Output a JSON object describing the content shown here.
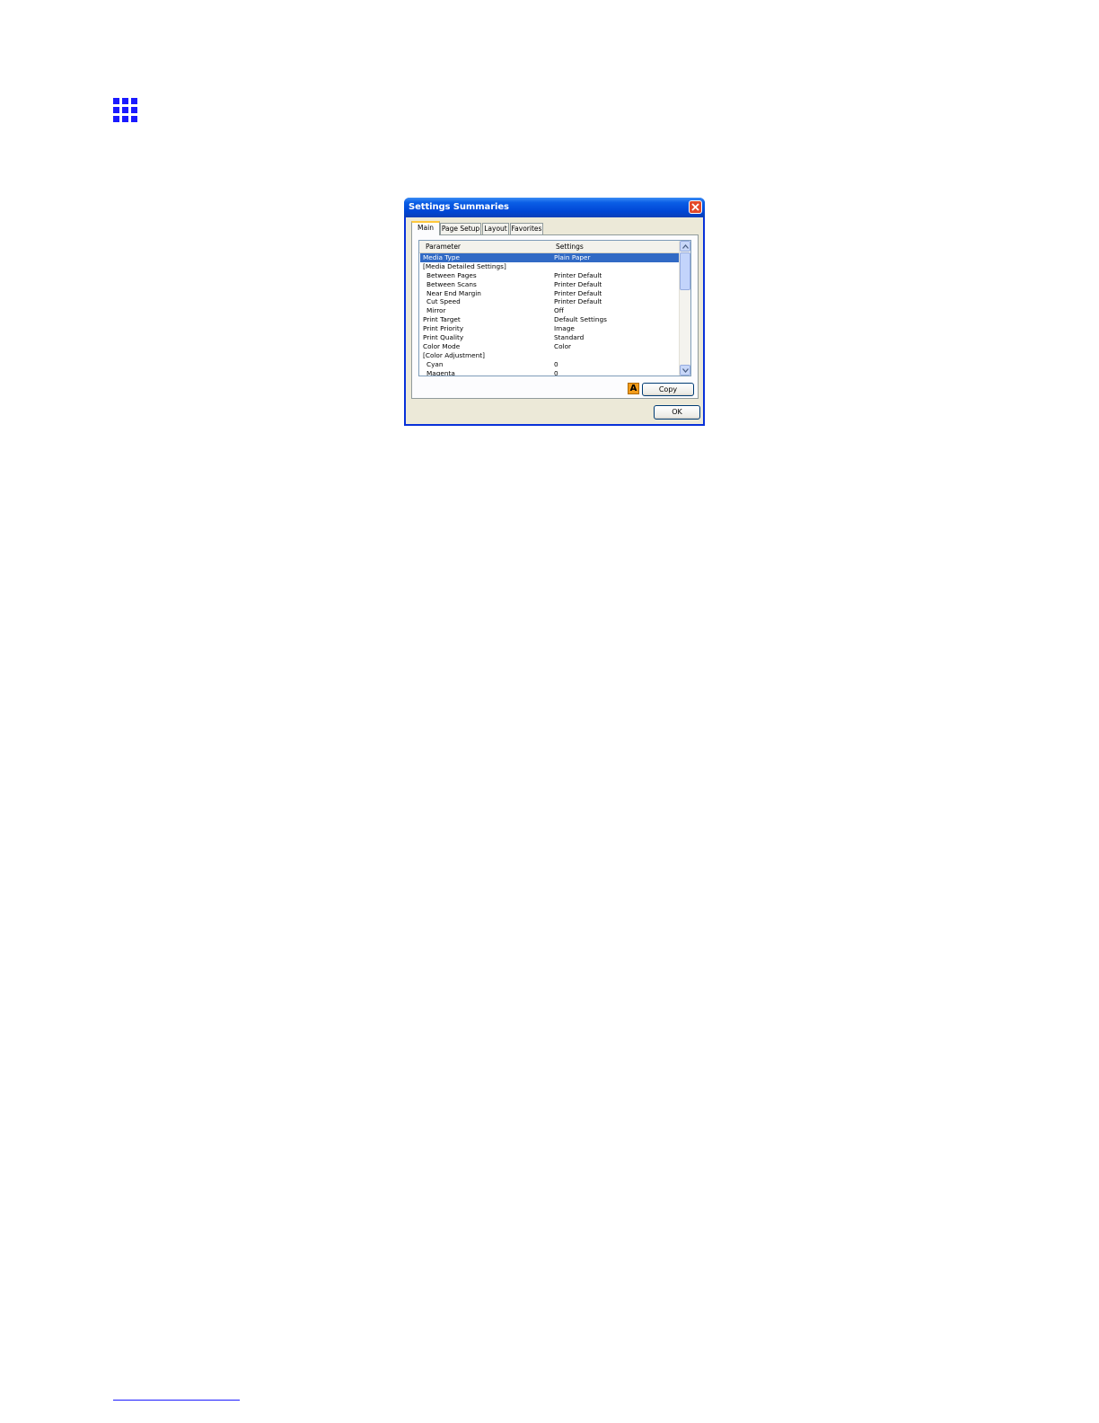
{
  "dialog": {
    "title": "Settings Summaries",
    "tabs": [
      {
        "label": "Main",
        "active": true
      },
      {
        "label": "Page Setup",
        "active": false
      },
      {
        "label": "Layout",
        "active": false
      },
      {
        "label": "Favorites",
        "active": false
      }
    ],
    "list": {
      "columns": {
        "parameter": "Parameter",
        "settings": "Settings"
      },
      "rows": [
        {
          "parameter": "Media Type",
          "setting": "Plain Paper",
          "selected": true
        },
        {
          "parameter": "[Media Detailed Settings]",
          "setting": ""
        },
        {
          "parameter": "Between Pages",
          "setting": "Printer Default",
          "indent": true
        },
        {
          "parameter": "Between Scans",
          "setting": "Printer Default",
          "indent": true
        },
        {
          "parameter": "Near End Margin",
          "setting": "Printer Default",
          "indent": true
        },
        {
          "parameter": "Cut Speed",
          "setting": "Printer Default",
          "indent": true
        },
        {
          "parameter": "Mirror",
          "setting": "Off",
          "indent": true
        },
        {
          "parameter": "Print Target",
          "setting": "Default Settings"
        },
        {
          "parameter": "Print Priority",
          "setting": "Image"
        },
        {
          "parameter": "Print Quality",
          "setting": "Standard"
        },
        {
          "parameter": "Color Mode",
          "setting": "Color"
        },
        {
          "parameter": "[Color Adjustment]",
          "setting": ""
        },
        {
          "parameter": "Cyan",
          "setting": "0",
          "indent": true
        },
        {
          "parameter": "Magenta",
          "setting": "0",
          "indent": true
        }
      ]
    },
    "copy_icon_letter": "A",
    "copy_label": "Copy",
    "ok_label": "OK"
  },
  "colors": {
    "accent_icon": "#1a1aff",
    "selection": "#316ac5",
    "titlebar": "#0a5ee6"
  }
}
